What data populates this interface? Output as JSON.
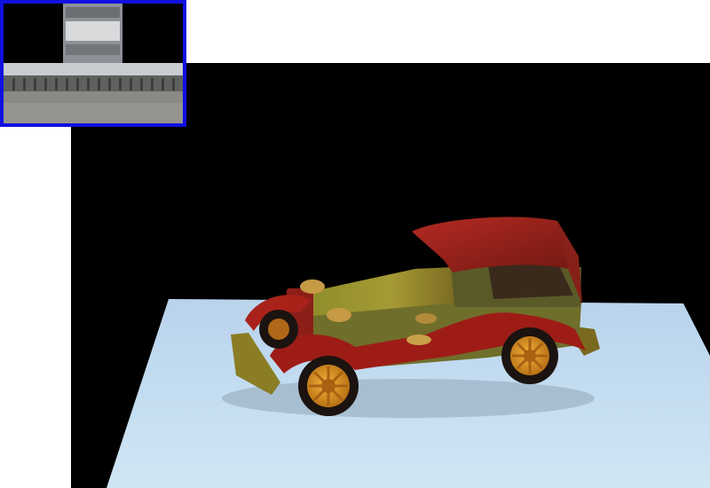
{
  "scene": {
    "background_color": "#000000",
    "table_color": "#c8dff0",
    "subject": "wooden-toy-vintage-car"
  },
  "environment_map": {
    "border_color": "#1010e0",
    "subject": "arcaded-courtyard-panorama"
  },
  "colors": {
    "car_body_red": "#9e1c16",
    "car_body_olive": "#8d8a2a",
    "wheel_wood": "#d6931e",
    "tire_dark": "#1b1310"
  }
}
